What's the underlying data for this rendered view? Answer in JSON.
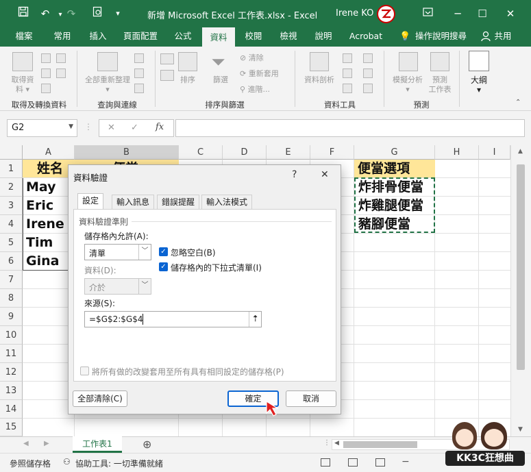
{
  "title_bar": {
    "document_title": "新增 Microsoft Excel 工作表.xlsx  -  Excel",
    "user": "Irene KO",
    "icons": [
      "save-icon",
      "undo-icon",
      "redo-icon",
      "print-preview-icon",
      "customize-icon",
      "ribbon-display-icon",
      "minimize-icon",
      "restore-icon",
      "close-icon"
    ]
  },
  "ribbon_tabs": [
    "檔案",
    "常用",
    "插入",
    "頁面配置",
    "公式",
    "資料",
    "校閱",
    "檢視",
    "說明",
    "Acrobat",
    "操作說明搜尋",
    "共用"
  ],
  "active_tab": "資料",
  "ribbon": {
    "groups": [
      {
        "label": "取得及轉換資料",
        "items": [
          "取得資",
          "料"
        ]
      },
      {
        "label": "查詢與連線",
        "items": [
          "全部重新整理"
        ]
      },
      {
        "label": "排序與篩選",
        "items": [
          "排序",
          "篩選",
          "清除",
          "重新套用",
          "進階..."
        ]
      },
      {
        "label": "資料工具",
        "items": [
          "資料剖析"
        ]
      },
      {
        "label": "預測",
        "items": [
          "模擬分析",
          "預測",
          "工作表"
        ]
      },
      {
        "label": "",
        "items": [
          "大綱"
        ]
      }
    ]
  },
  "formula_bar": {
    "name_box": "G2",
    "cancel": "✕",
    "enter": "✓",
    "fx": "fx",
    "formula": ""
  },
  "columns": [
    "A",
    "B",
    "C",
    "D",
    "E",
    "F",
    "G",
    "H",
    "I"
  ],
  "rows": [
    "1",
    "2",
    "3",
    "4",
    "5",
    "6",
    "7",
    "8",
    "9",
    "10",
    "11",
    "12",
    "13",
    "14",
    "15"
  ],
  "cells": {
    "A1": "姓名",
    "B1": "便當",
    "A2": "May",
    "A3": "Eric",
    "A4": "Irene",
    "A5": "Tim",
    "A6": "Gina",
    "G1": "便當選項",
    "G2": "炸排骨便當",
    "G3": "炸雞腿便當",
    "G4": "豬腳便當"
  },
  "colors": {
    "excel_green": "#217346",
    "header_fill": "#ffe699",
    "accent_blue": "#0a64d2",
    "selection_border": "#217346"
  },
  "sheet_tabs": {
    "active": "工作表1",
    "add_label": "⊕"
  },
  "status_bar": {
    "mode": "參照儲存格",
    "accessibility": "協助工具: 一切準備就緒"
  },
  "dialog": {
    "title": "資料驗證",
    "help": "?",
    "close": "✕",
    "tabs": [
      "設定",
      "輸入訊息",
      "錯誤提醒",
      "輸入法模式"
    ],
    "active_tab": "設定",
    "section": "資料驗證準則",
    "allow_label": "儲存格內允許(A):",
    "allow_value": "清單",
    "ignore_blank": "忽略空白(B)",
    "in_cell_dropdown": "儲存格內的下拉式清單(I)",
    "data_label": "資料(D):",
    "data_value": "介於",
    "source_label": "來源(S):",
    "source_value": "=$G$2:$G$4",
    "apply_all": "將所有做的改變套用至所有具有相同設定的儲存格(P)",
    "clear_all": "全部清除(C)",
    "ok": "確定",
    "cancel": "取消"
  },
  "watermark": "KK3C狂想曲"
}
